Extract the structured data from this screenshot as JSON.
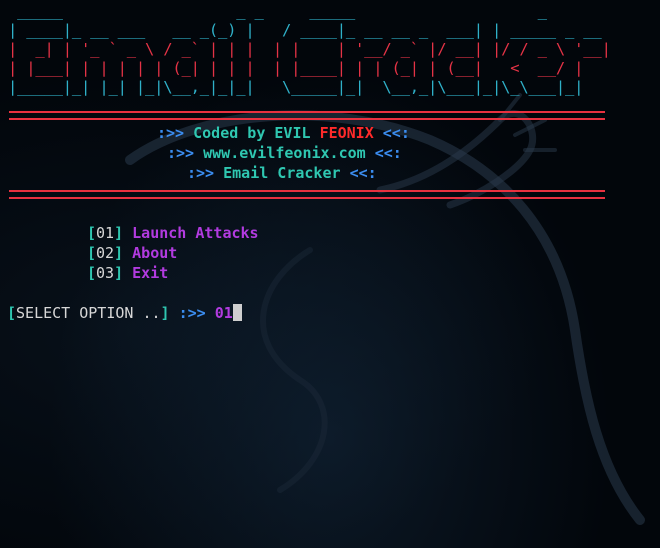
{
  "banner": {
    "lines": [
      " _____                   _ _     _____                    _",
      "| ____|_ __ ___   __ _(_) |   / ____|_ __ __ _  ___| | _____ _ __",
      "|  _| | '_ ` _ \\ / _` | | |  | |    | '__/ _` |/ __| |/ / _ \\ '__|",
      "| |___| | | | | | (_| | | |  | |____| | | (_| | (__|   <  __/ |",
      "|_____|_| |_| |_|\\__,_|_|_|   \\_____|_|  \\__,_|\\___|_|\\_\\___|_|"
    ]
  },
  "info": {
    "line1": {
      "prefix": ":>>",
      "label": "Coded by EVIL",
      "accent": "FEONIX",
      "suffix": "<<:"
    },
    "line2": {
      "prefix": ":>>",
      "label": "www.evilfeonix.com",
      "suffix": "<<:"
    },
    "line3": {
      "prefix": ":>>",
      "label": "Email Cracker",
      "suffix": "<<:"
    }
  },
  "menu": [
    {
      "open": "[",
      "num": "01",
      "close": "]",
      "label": "Launch Attacks"
    },
    {
      "open": "[",
      "num": "02",
      "close": "]",
      "label": "About"
    },
    {
      "open": "[",
      "num": "03",
      "close": "]",
      "label": "Exit"
    }
  ],
  "prompt": {
    "open": "[",
    "text": "SELECT OPTION",
    "dots": "..",
    "close": "]",
    "arrow": ":>>",
    "value": "01"
  },
  "colors": {
    "background": "#02060b",
    "banner_cyan": "#2fb0c8",
    "banner_red": "#e43346",
    "rule_red": "#e8313f",
    "info_blue": "#3b8df0",
    "info_teal": "#2fc7b1",
    "accent_red": "#ff2a2a",
    "menu_purple": "#b23be0"
  }
}
